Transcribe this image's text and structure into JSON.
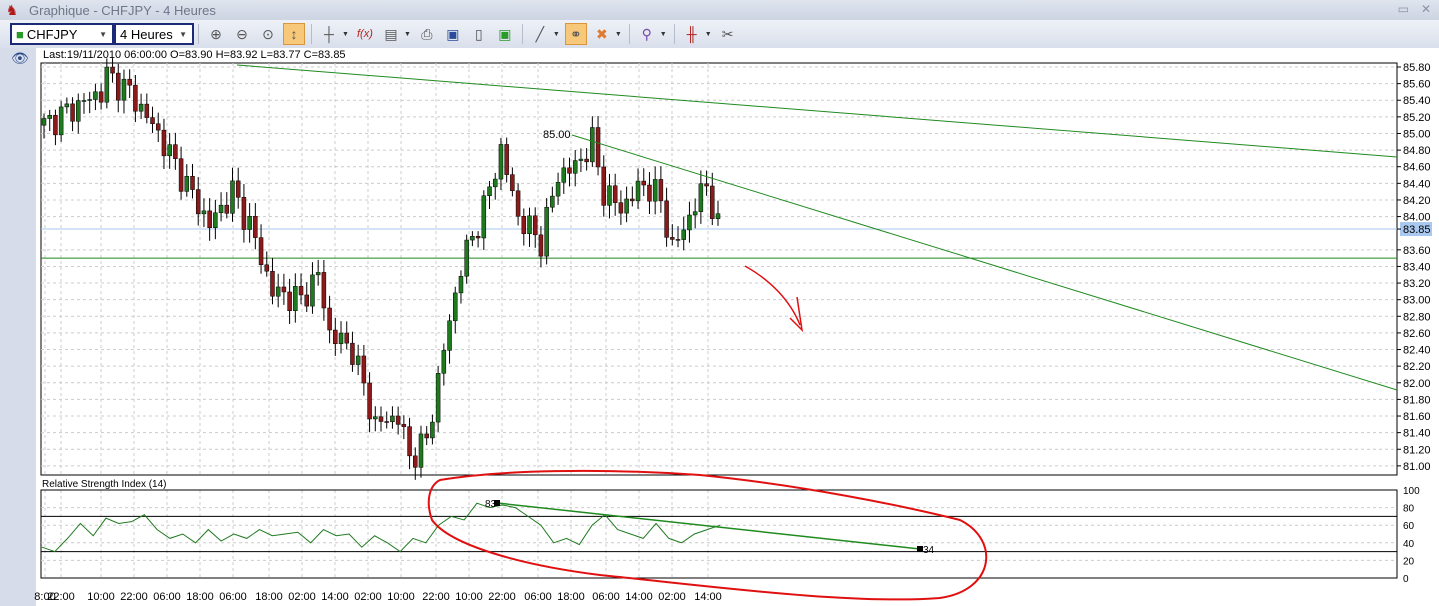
{
  "window": {
    "title": "Graphique - CHFJPY - 4 Heures"
  },
  "toolbar": {
    "symbol": "CHFJPY",
    "timeframe": "4 Heures",
    "icons": [
      "zoom-in-icon",
      "zoom-out-icon",
      "zoom-fit-icon",
      "autoscale-icon",
      "crosshair-icon",
      "function-icon",
      "indicator-window-icon",
      "print-icon",
      "save-icon",
      "document-icon",
      "save-chart-icon",
      "line-tool-icon",
      "link-icon",
      "delete-objects-icon",
      "pin-icon",
      "candlestick-icon",
      "settings-tools-icon"
    ]
  },
  "info": {
    "last": "Last:19/11/2010 06:00:00 O=83.90 H=83.92 L=83.77 C=83.85"
  },
  "chart_data": [
    {
      "type": "candlestick",
      "title": "CHFJPY 4 Heures",
      "ylim": [
        80.9,
        85.9
      ],
      "yticks": [
        "85.80",
        "85.60",
        "85.40",
        "85.20",
        "85.00",
        "84.80",
        "84.60",
        "84.40",
        "84.20",
        "84.00",
        "83.85",
        "83.60",
        "83.40",
        "83.20",
        "83.00",
        "82.80",
        "82.60",
        "82.40",
        "82.20",
        "82.00",
        "81.80",
        "81.60",
        "81.40",
        "81.20",
        "81.00"
      ],
      "current_price": "83.85",
      "support_level": 83.5,
      "trendline_label": "85.00",
      "close_path": [
        [
          0,
          85.1
        ],
        [
          10,
          85.5
        ],
        [
          11,
          85.7
        ],
        [
          15,
          85.5
        ],
        [
          20,
          85.0
        ],
        [
          24,
          84.5
        ],
        [
          29,
          83.9
        ],
        [
          33,
          84.3
        ],
        [
          36,
          83.9
        ],
        [
          40,
          83.1
        ],
        [
          45,
          83.0
        ],
        [
          48,
          83.3
        ],
        [
          50,
          82.6
        ],
        [
          54,
          82.4
        ],
        [
          58,
          81.5
        ],
        [
          62,
          81.6
        ],
        [
          64,
          81.1
        ],
        [
          67,
          81.3
        ],
        [
          70,
          82.4
        ],
        [
          73,
          83.4
        ],
        [
          77,
          84.1
        ],
        [
          80,
          84.8
        ],
        [
          83,
          84.0
        ],
        [
          87,
          83.7
        ],
        [
          90,
          84.5
        ],
        [
          93,
          84.6
        ],
        [
          96,
          84.9
        ],
        [
          98,
          84.3
        ],
        [
          101,
          84.1
        ],
        [
          105,
          84.4
        ],
        [
          108,
          84.2
        ],
        [
          110,
          83.6
        ],
        [
          113,
          84.0
        ],
        [
          116,
          84.4
        ],
        [
          118,
          83.85
        ]
      ]
    },
    {
      "type": "line",
      "title": "Relative Strength Index (14)",
      "ylim": [
        0,
        100
      ],
      "yticks": [
        "100",
        "80",
        "60",
        "40",
        "20",
        "0"
      ],
      "levels": [
        70,
        30
      ],
      "trendline_labels": [
        "83",
        "34"
      ],
      "values": [
        35,
        30,
        45,
        62,
        48,
        68,
        62,
        64,
        72,
        55,
        45,
        50,
        40,
        55,
        42,
        50,
        45,
        55,
        48,
        50,
        52,
        40,
        55,
        48,
        50,
        35,
        48,
        40,
        30,
        45,
        40,
        60,
        70,
        66,
        85,
        80,
        83,
        80,
        70,
        60,
        40,
        45,
        38,
        60,
        72,
        55,
        50,
        45,
        62,
        45,
        40,
        50,
        55,
        60
      ]
    },
    {
      "type": "axis",
      "xticks": [
        "8:00",
        "22:00",
        "10:00",
        "22:00",
        "06:00",
        "18:00",
        "06:00",
        "18:00",
        "02:00",
        "14:00",
        "02:00",
        "10:00",
        "22:00",
        "10:00",
        "22:00",
        "06:00",
        "18:00",
        "06:00",
        "14:00",
        "02:00",
        "14:00"
      ]
    }
  ],
  "colors": {
    "bull": "#1f7a1f",
    "bear": "#8b1a1a",
    "trend": "#1f8a1f",
    "annot": "#e01010",
    "current": "#a9c8f0"
  }
}
